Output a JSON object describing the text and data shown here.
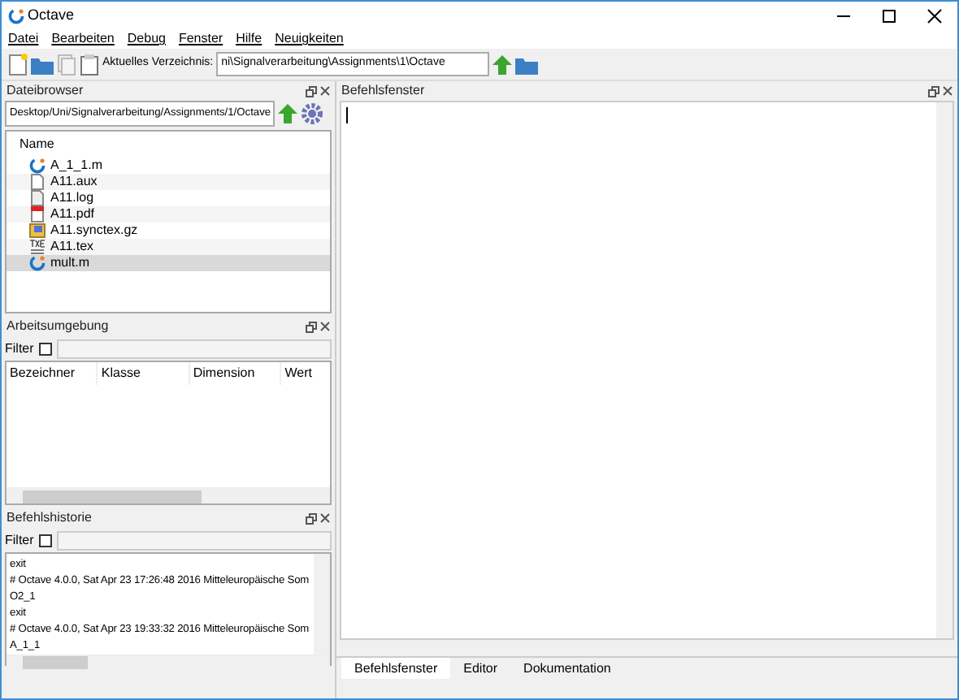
{
  "window": {
    "title": "Octave"
  },
  "menu": [
    "Datei",
    "Bearbeiten",
    "Debug",
    "Fenster",
    "Hilfe",
    "Neuigkeiten"
  ],
  "toolbar": {
    "directory_label": "Aktuelles Verzeichnis:",
    "directory": "ni\\Signalverarbeitung\\Assignments\\1\\Octave"
  },
  "file_browser": {
    "title": "Dateibrowser",
    "path": "Desktop/Uni/Signalverarbeitung/Assignments/1/Octave",
    "column": "Name",
    "files": [
      {
        "name": "A_1_1.m",
        "kind": "octave",
        "selected": false
      },
      {
        "name": "A11.aux",
        "kind": "text",
        "selected": false
      },
      {
        "name": "A11.log",
        "kind": "log",
        "selected": false
      },
      {
        "name": "A11.pdf",
        "kind": "pdf",
        "selected": false
      },
      {
        "name": "A11.synctex.gz",
        "kind": "archive",
        "selected": false
      },
      {
        "name": "A11.tex",
        "kind": "tex",
        "selected": false
      },
      {
        "name": "mult.m",
        "kind": "octave",
        "selected": true
      }
    ]
  },
  "workspace": {
    "title": "Arbeitsumgebung",
    "filter_label": "Filter",
    "filter_checked": false,
    "columns": [
      "Bezeichner",
      "Klasse",
      "Dimension",
      "Wert"
    ]
  },
  "history": {
    "title": "Befehlshistorie",
    "filter_label": "Filter",
    "filter_checked": false,
    "lines": [
      "exit",
      "# Octave 4.0.0, Sat Apr 23 17:26:48 2016 Mitteleuropäische Som",
      "O2_1",
      "exit",
      "# Octave 4.0.0, Sat Apr 23 19:33:32 2016 Mitteleuropäische Som",
      "A_1_1"
    ]
  },
  "command_window": {
    "title": "Befehlsfenster"
  },
  "tabs": [
    {
      "label": "Befehlsfenster",
      "selected": true
    },
    {
      "label": "Editor",
      "selected": false
    },
    {
      "label": "Dokumentation",
      "selected": false
    }
  ]
}
